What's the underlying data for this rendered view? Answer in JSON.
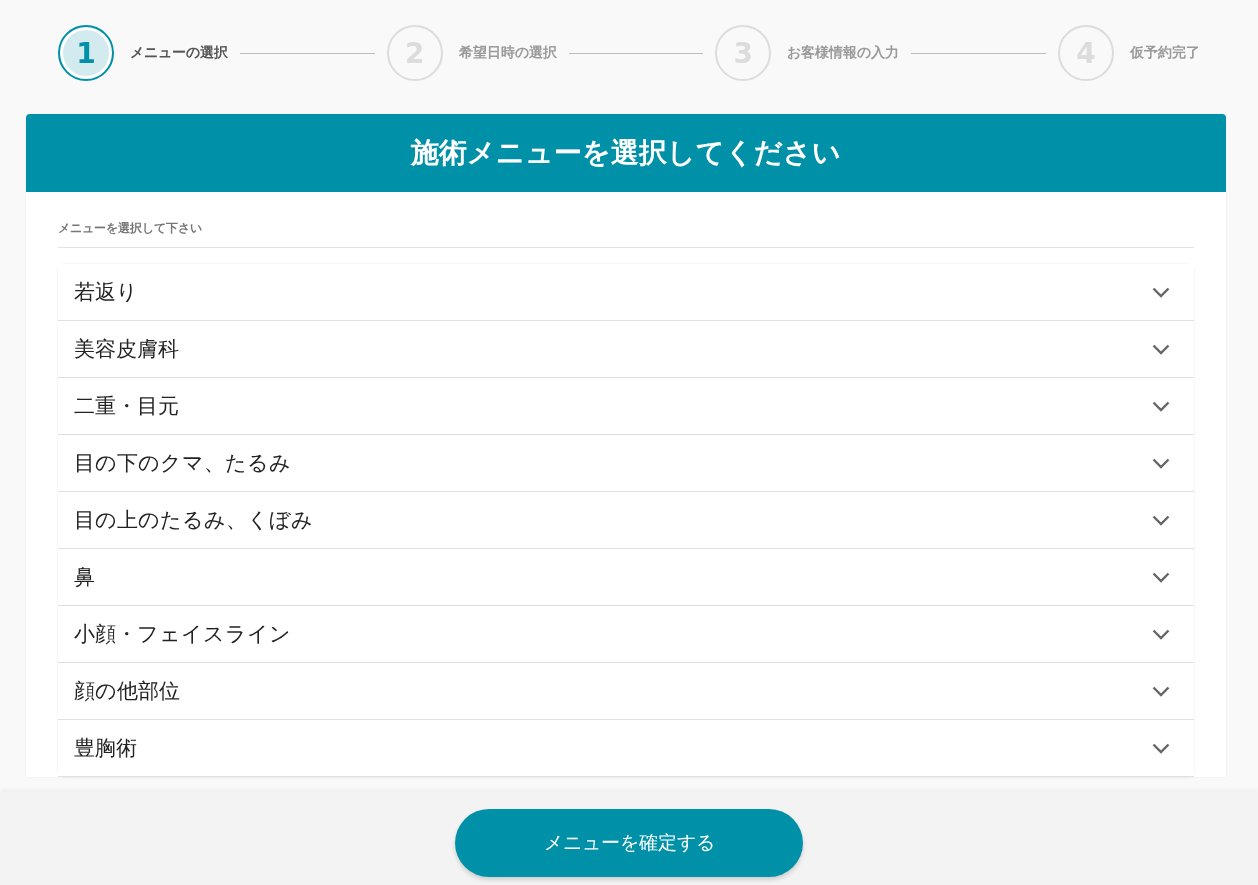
{
  "steps": [
    {
      "number": "1",
      "label": "メニューの選択",
      "selected": true
    },
    {
      "number": "2",
      "label": "希望日時の選択",
      "selected": false
    },
    {
      "number": "3",
      "label": "お客様情報の入力",
      "selected": false
    },
    {
      "number": "4",
      "label": "仮予約完了",
      "selected": false
    }
  ],
  "panel": {
    "title": "施術メニューを選択してください",
    "section_label": "メニューを選択して下さい",
    "categories": [
      {
        "label": "若返り",
        "expanded": false
      },
      {
        "label": "美容皮膚科",
        "expanded": false
      },
      {
        "label": "二重・目元",
        "expanded": false
      },
      {
        "label": "目の下のクマ、たるみ",
        "expanded": false
      },
      {
        "label": "目の上のたるみ、くぼみ",
        "expanded": false
      },
      {
        "label": "鼻",
        "expanded": false
      },
      {
        "label": "小顔・フェイスライン",
        "expanded": false
      },
      {
        "label": "顔の他部位",
        "expanded": false
      },
      {
        "label": "豊胸術",
        "expanded": false
      }
    ]
  },
  "footer": {
    "button": "メニューを確定する"
  }
}
